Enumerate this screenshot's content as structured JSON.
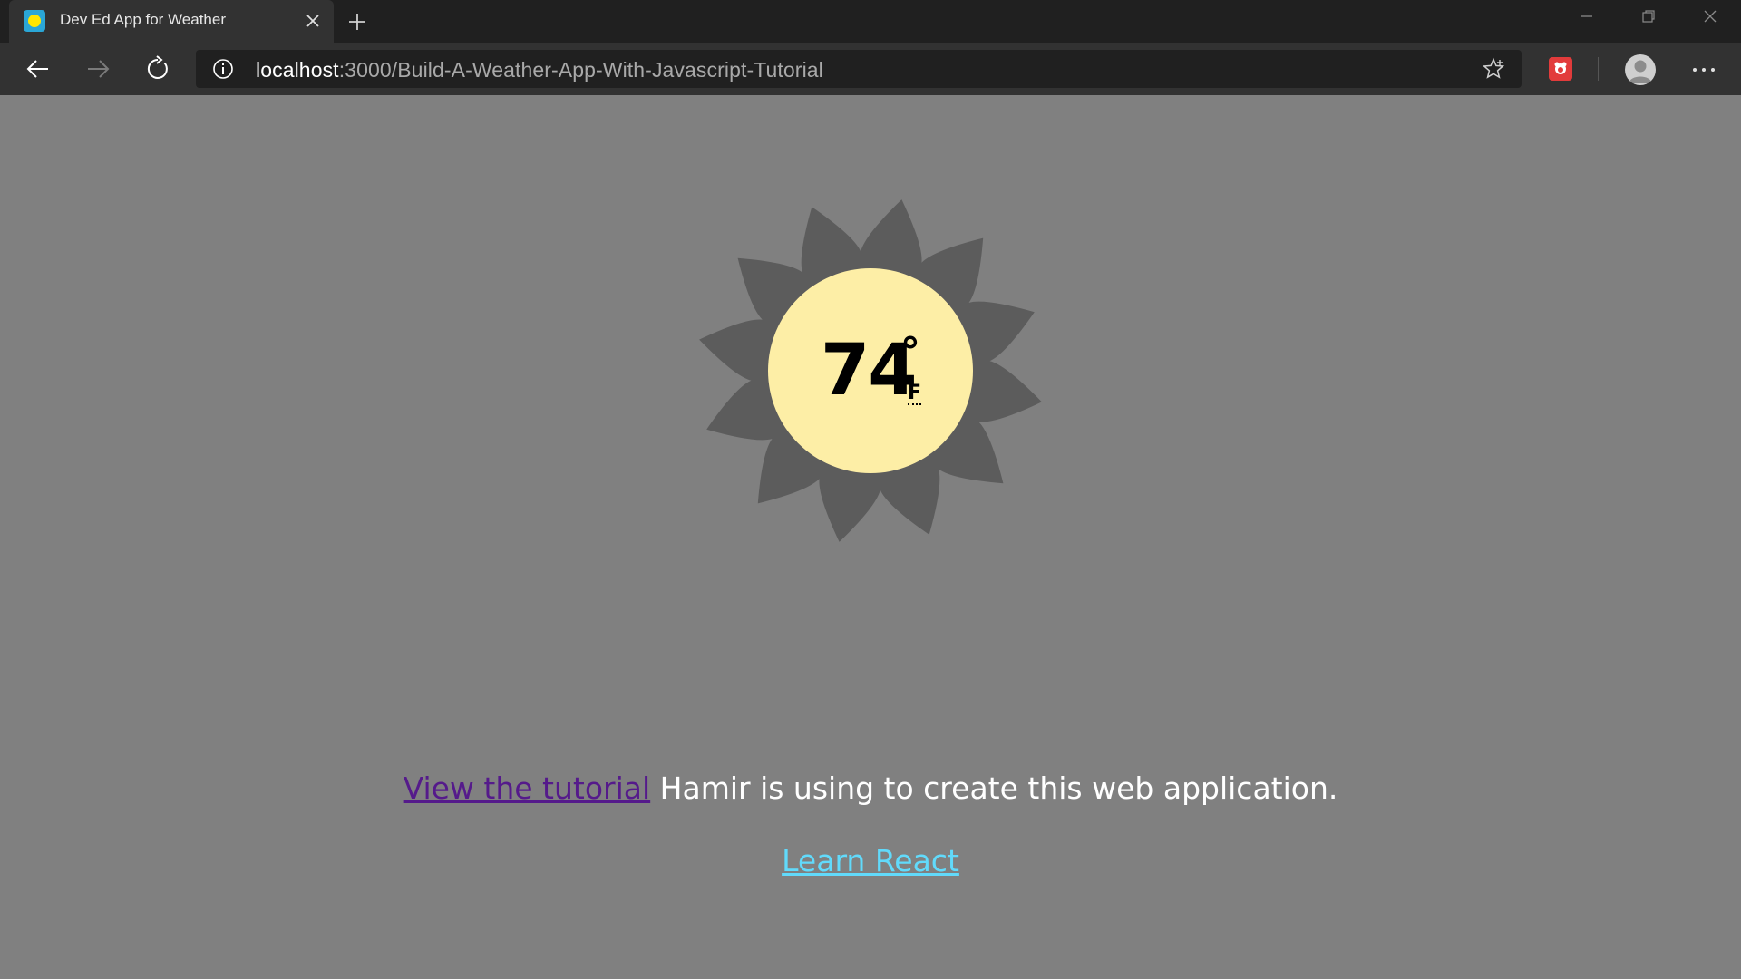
{
  "browser": {
    "tab": {
      "title": "Dev Ed App for Weather",
      "favicon": "sun-favicon-icon"
    },
    "url_host": "localhost",
    "url_rest": ":3000/Build-A-Weather-App-With-Javascript-Tutorial",
    "icons": {
      "back": "arrow-left-icon",
      "forward": "arrow-right-icon",
      "reload": "reload-icon",
      "info": "info-icon",
      "favorite": "star-icon",
      "extension": "extension-icon",
      "profile": "avatar-icon",
      "more": "ellipsis-icon"
    }
  },
  "weather": {
    "temperature": "74",
    "degree_symbol": "°",
    "unit": "F",
    "colors": {
      "sun_rays": "#5c5c5c",
      "sun_face": "#fdeea6",
      "background": "#808080"
    }
  },
  "footer": {
    "tutorial_link": "View the tutorial",
    "tutorial_text": " Hamir is using to create this web application.",
    "learn_react": "Learn React"
  },
  "colors": {
    "visited_link": "#551a8b",
    "react_link": "#61dafb"
  }
}
